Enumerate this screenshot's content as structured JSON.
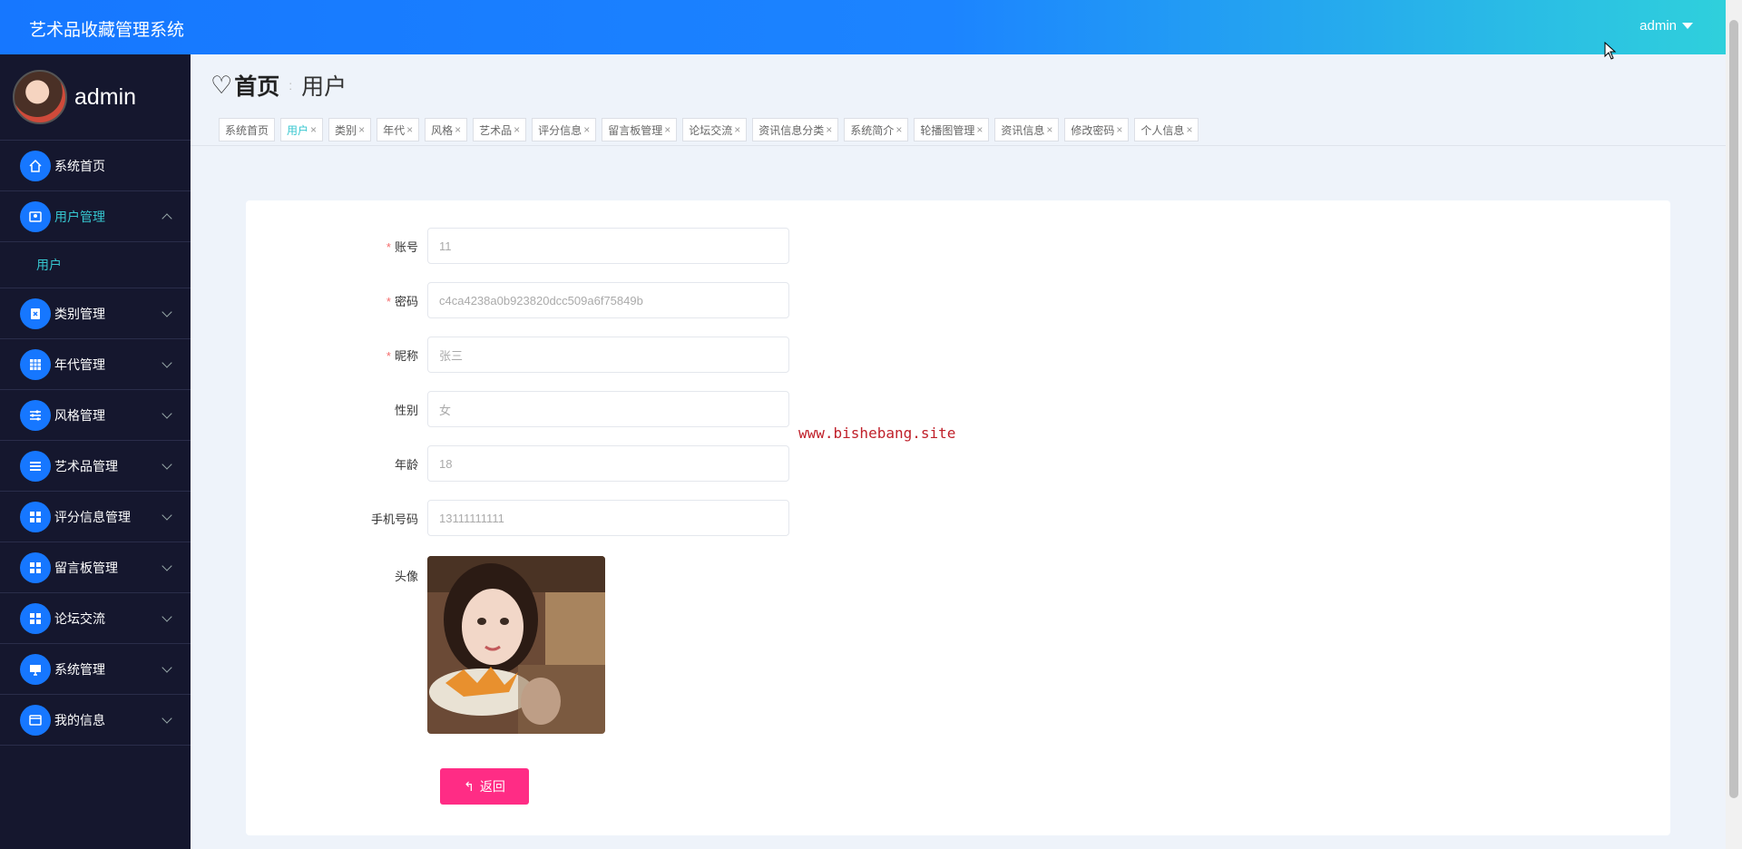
{
  "header": {
    "app_title": "艺术品收藏管理系统",
    "user": "admin"
  },
  "sidebar": {
    "profile_name": "admin",
    "items": [
      {
        "label": "系统首页",
        "icon": "home-icon"
      },
      {
        "label": "用户管理",
        "icon": "user-icon",
        "expanded": true,
        "children": [
          "用户"
        ]
      },
      {
        "label": "类别管理",
        "icon": "clipboard-icon"
      },
      {
        "label": "年代管理",
        "icon": "grid-icon"
      },
      {
        "label": "风格管理",
        "icon": "sliders-icon"
      },
      {
        "label": "艺术品管理",
        "icon": "list-icon"
      },
      {
        "label": "评分信息管理",
        "icon": "apps-icon"
      },
      {
        "label": "留言板管理",
        "icon": "apps-icon"
      },
      {
        "label": "论坛交流",
        "icon": "apps-icon"
      },
      {
        "label": "系统管理",
        "icon": "monitor-icon"
      },
      {
        "label": "我的信息",
        "icon": "wallet-icon"
      }
    ]
  },
  "breadcrumb": {
    "home": "首页",
    "current": "用户"
  },
  "tabs": [
    {
      "label": "系统首页",
      "closable": false
    },
    {
      "label": "用户",
      "closable": true,
      "active": true
    },
    {
      "label": "类别",
      "closable": true
    },
    {
      "label": "年代",
      "closable": true
    },
    {
      "label": "风格",
      "closable": true
    },
    {
      "label": "艺术品",
      "closable": true
    },
    {
      "label": "评分信息",
      "closable": true
    },
    {
      "label": "留言板管理",
      "closable": true
    },
    {
      "label": "论坛交流",
      "closable": true
    },
    {
      "label": "资讯信息分类",
      "closable": true
    },
    {
      "label": "系统简介",
      "closable": true
    },
    {
      "label": "轮播图管理",
      "closable": true
    },
    {
      "label": "资讯信息",
      "closable": true
    },
    {
      "label": "修改密码",
      "closable": true
    },
    {
      "label": "个人信息",
      "closable": true
    }
  ],
  "form": {
    "account": {
      "label": "账号",
      "value": "11",
      "required": true
    },
    "password": {
      "label": "密码",
      "value": "c4ca4238a0b923820dcc509a6f75849b",
      "required": true
    },
    "nickname": {
      "label": "昵称",
      "value": "张三",
      "required": true
    },
    "gender": {
      "label": "性别",
      "value": "女"
    },
    "age": {
      "label": "年龄",
      "value": "18"
    },
    "phone": {
      "label": "手机号码",
      "value": "13111111111"
    },
    "avatar": {
      "label": "头像"
    },
    "back_button": "返回"
  },
  "watermark": "www.bishebang.site",
  "colors": {
    "primary": "#1677ff",
    "accent_teal": "#36c6cf",
    "sidebar_bg": "#15172e",
    "back_button": "#ff2c85",
    "required": "#f56c6c"
  }
}
